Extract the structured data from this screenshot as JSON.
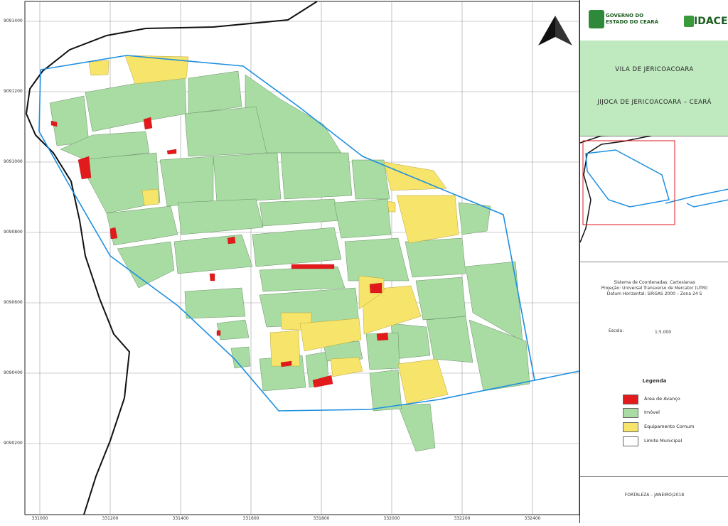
{
  "y_ticks": [
    "9091400",
    "9091200",
    "9091000",
    "9090800",
    "9090600",
    "9090400",
    "9090200"
  ],
  "x_ticks": [
    "331000",
    "331200",
    "331400",
    "331600",
    "331800",
    "332000",
    "332200",
    "332400"
  ],
  "colors": {
    "area_avanco": "#e31a1c",
    "imovel": "#a8dca3",
    "equipamento": "#f6e46b",
    "limite": "#1e8fe0",
    "coast": "#111111",
    "title_bg": "#bfe9bf"
  },
  "header": {
    "logo_left_line1": "GOVERNO DO",
    "logo_left_line2": "ESTADO DO CEARÁ",
    "logo_right": "IDACE"
  },
  "title": {
    "line1": "VILA DE JERICOACOARA",
    "line2": "JIJOCA DE JERICOACOARA – CEARÁ"
  },
  "projection": {
    "line1": "Sistema de Coordenadas: Cartesianas",
    "line2": "Projeção: Universal Transverso de Mercator (UTM)",
    "line3": "Datum Horizontal: SIRGAS 2000 – Zona 24 S"
  },
  "scale": {
    "label": "Escala:",
    "value": "1:5.000"
  },
  "legend": {
    "title": "Legenda",
    "items": [
      "Área de Avanço",
      "Imóvel",
      "Equipamento Comum",
      "Limite Municipal"
    ]
  },
  "footer": "FORTALEZA – JANEIRO/2018",
  "north_icon": "north-arrow-icon"
}
